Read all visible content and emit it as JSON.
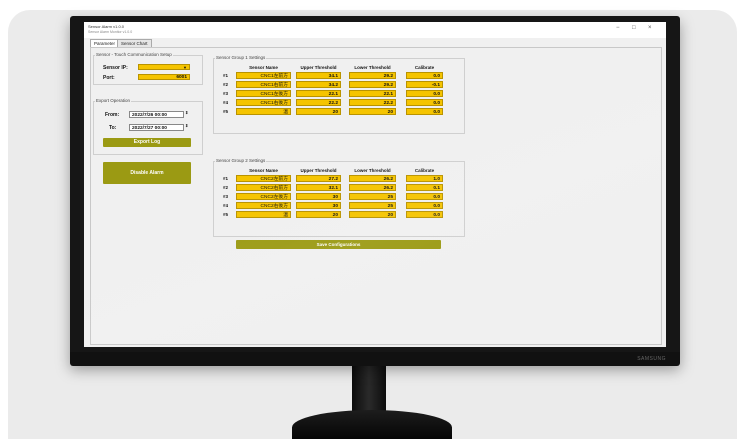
{
  "window": {
    "title": "Sensor Alarm v1.0.0",
    "subtitle": "Sensor Alarm Monitor v1.0.0",
    "minimize": "−",
    "maximize": "□",
    "close": "×"
  },
  "tabs": [
    "Parameter",
    "Sensor Chart"
  ],
  "comm_group": {
    "title": "Sensor - Touch Communication Setup",
    "ip_label": "Sensor IP:",
    "ip_value": "",
    "port_label": "Port:",
    "port_value": "6001"
  },
  "export_group": {
    "title": "Export Operation",
    "from_label": "From:",
    "from_value": "2022/7/26 00:00",
    "to_label": "To:",
    "to_value": "2022/7/27 00:00",
    "export_button": "Export Log"
  },
  "disable_alarm_button": "Disable Alarm",
  "headers": {
    "sensor_name": "Sensor Name",
    "upper": "Upper Threshold",
    "lower": "Lower Threshold",
    "calibrate": "Calibrate"
  },
  "group1": {
    "title": "Sensor Group 1 Settings",
    "rows": [
      {
        "id": "#1",
        "name": "CNC1左前方",
        "upper": "34.1",
        "lower": "29.2",
        "cal": "0.0"
      },
      {
        "id": "#2",
        "name": "CNC1右前方",
        "upper": "34.2",
        "lower": "29.2",
        "cal": "-0.1"
      },
      {
        "id": "#3",
        "name": "CNC1左後方",
        "upper": "22.1",
        "lower": "22.1",
        "cal": "0.0"
      },
      {
        "id": "#4",
        "name": "CNC1右後方",
        "upper": "22.2",
        "lower": "22.2",
        "cal": "0.0"
      },
      {
        "id": "#5",
        "name": "溫",
        "upper": "20",
        "lower": "20",
        "cal": "0.0"
      }
    ]
  },
  "group2": {
    "title": "Sensor Group 2 Settings",
    "rows": [
      {
        "id": "#1",
        "name": "CNC2左前方",
        "upper": "27.2",
        "lower": "26.2",
        "cal": "1.0"
      },
      {
        "id": "#2",
        "name": "CNC2右前方",
        "upper": "32.1",
        "lower": "26.2",
        "cal": "0.1"
      },
      {
        "id": "#3",
        "name": "CNC2左後方",
        "upper": "30",
        "lower": "25",
        "cal": "0.0"
      },
      {
        "id": "#4",
        "name": "CNC2右後方",
        "upper": "30",
        "lower": "25",
        "cal": "0.0"
      },
      {
        "id": "#5",
        "name": "溫",
        "upper": "20",
        "lower": "20",
        "cal": "0.0"
      }
    ]
  },
  "save_button": "Save Configurations",
  "monitor_brand": "SAMSUNG",
  "colors": {
    "field_yellow": "#f5c400",
    "button_olive": "#9b9a13"
  }
}
